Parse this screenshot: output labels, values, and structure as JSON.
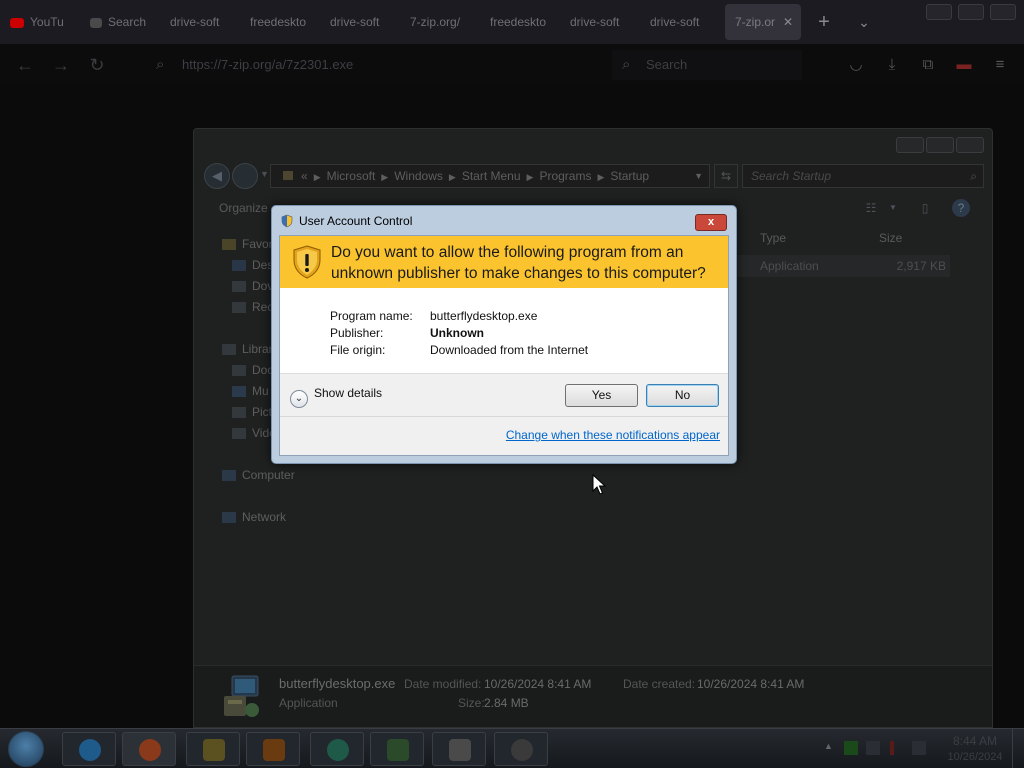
{
  "browser": {
    "tabs": [
      {
        "label": "YouTu",
        "color": "#cc0000"
      },
      {
        "label": "Search",
        "color": "#555555"
      },
      {
        "label": "drive-soft",
        "color": ""
      },
      {
        "label": "freedeskto",
        "color": ""
      },
      {
        "label": "drive-soft",
        "color": ""
      },
      {
        "label": "7-zip.org/",
        "color": ""
      },
      {
        "label": "freedeskto",
        "color": ""
      },
      {
        "label": "drive-soft",
        "color": ""
      },
      {
        "label": "drive-soft",
        "color": ""
      },
      {
        "label": "7-zip.or",
        "color": "",
        "active": true
      }
    ],
    "url": "https://7-zip.org/a/7z2301.exe",
    "search_placeholder": "Search"
  },
  "explorer": {
    "breadcrumb": [
      "Microsoft",
      "Windows",
      "Start Menu",
      "Programs",
      "Startup"
    ],
    "breadcrumb_prefix": "«",
    "search_placeholder": "Search Startup",
    "organize_label": "Organize",
    "nav": {
      "favorites": "Favor",
      "desktop": "Des",
      "downloads": "Dov",
      "recent": "Rec",
      "libraries": "Librar",
      "documents": "Doc",
      "music": "Mu",
      "pictures": "Pict",
      "videos": "Vide",
      "computer": "Computer",
      "network": "Network"
    },
    "columns": {
      "type": "Type",
      "size": "Size"
    },
    "file": {
      "type": "Application",
      "size": "2,917 KB"
    },
    "details": {
      "name": "butterflydesktop.exe",
      "kind": "Application",
      "date_modified_label": "Date modified:",
      "date_modified": "10/26/2024 8:41 AM",
      "size_label": "Size:",
      "size": "2.84 MB",
      "date_created_label": "Date created:",
      "date_created": "10/26/2024 8:41 AM"
    }
  },
  "uac": {
    "title": "User Account Control",
    "close_label": "x",
    "question": "Do you want to allow the following program from an unknown publisher to make changes to this computer?",
    "program_name_label": "Program name:",
    "program_name": "butterflydesktop.exe",
    "publisher_label": "Publisher:",
    "publisher": "Unknown",
    "file_origin_label": "File origin:",
    "file_origin": "Downloaded from the Internet",
    "show_details": "Show details",
    "yes": "Yes",
    "no": "No",
    "change_link": "Change when these notifications appear",
    "banner_color": "#fbc42e"
  },
  "taskbar": {
    "time": "8:44 AM",
    "date": "10/26/2024"
  },
  "icons": {
    "uac_shield": "shield-warning-icon",
    "show_details_chevron": "chevron-down-icon"
  }
}
